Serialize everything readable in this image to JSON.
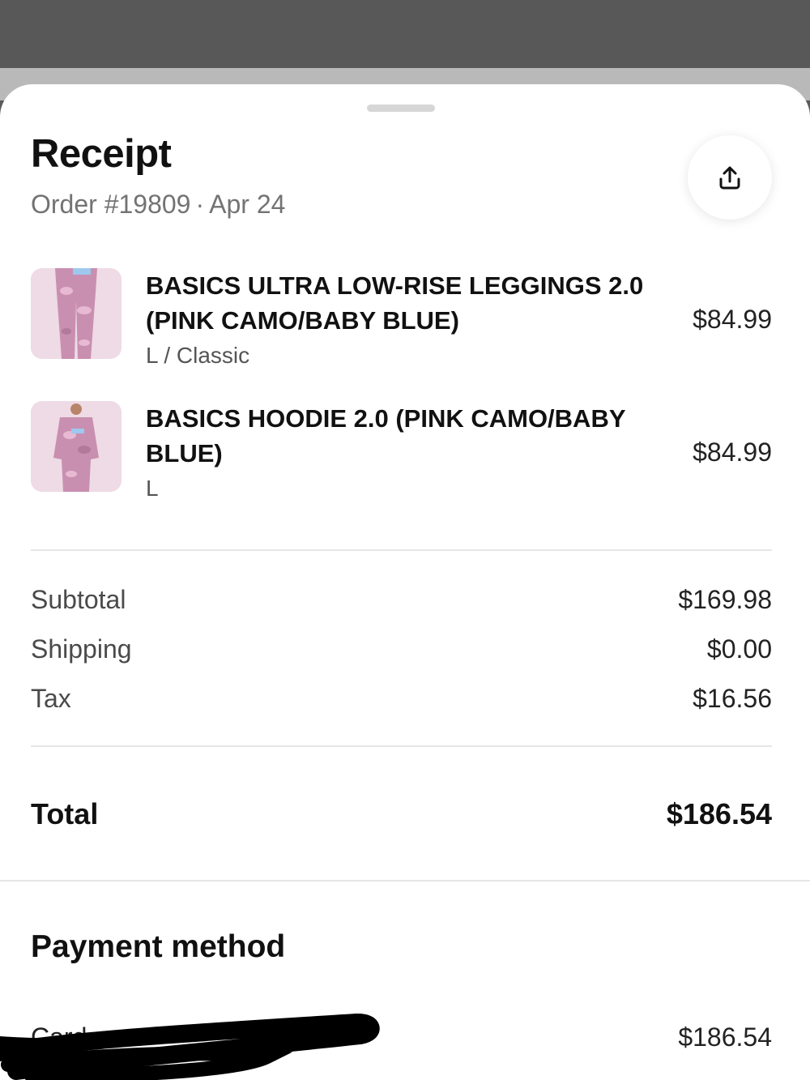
{
  "receipt": {
    "title": "Receipt",
    "order_number": "Order #19809",
    "separator": "·",
    "date": "Apr 24",
    "share_icon": "share-upload-icon"
  },
  "items": [
    {
      "name": "BASICS ULTRA LOW-RISE LEGGINGS 2.0 (PINK CAMO/BABY BLUE)",
      "variant": "L / Classic",
      "price": "$84.99",
      "image": "pink-camo-leggings-photo"
    },
    {
      "name": "BASICS HOODIE 2.0 (PINK CAMO/BABY BLUE)",
      "variant": "L",
      "price": "$84.99",
      "image": "pink-camo-hoodie-photo"
    }
  ],
  "summary": {
    "subtotal_label": "Subtotal",
    "subtotal_value": "$169.98",
    "shipping_label": "Shipping",
    "shipping_value": "$0.00",
    "tax_label": "Tax",
    "tax_value": "$16.56",
    "total_label": "Total",
    "total_value": "$186.54"
  },
  "payment": {
    "heading": "Payment method",
    "card_label": "Card",
    "card_value": "$186.54"
  },
  "colors": {
    "sheet_background": "#ffffff",
    "muted_text": "#737373",
    "thumb_pink": "#c98fb0"
  }
}
